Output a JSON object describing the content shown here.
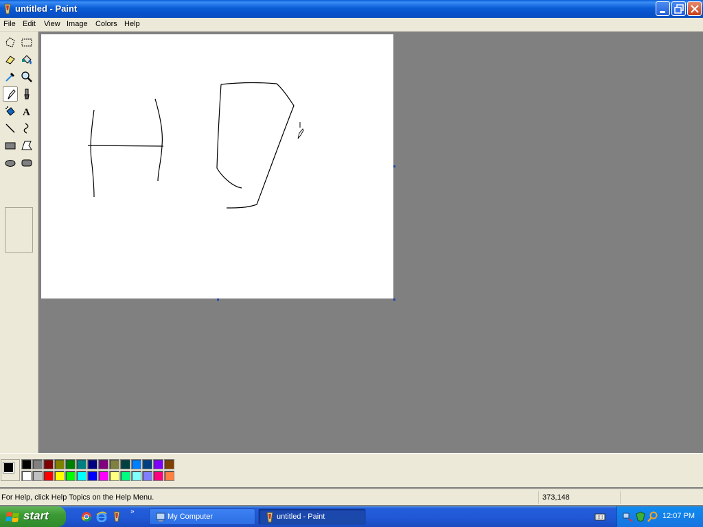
{
  "window": {
    "title": "untitled - Paint",
    "controls": [
      "minimize-icon",
      "maximize-icon",
      "close-icon"
    ]
  },
  "menubar": {
    "items": [
      "File",
      "Edit",
      "View",
      "Image",
      "Colors",
      "Help"
    ]
  },
  "toolbox": {
    "tools": [
      {
        "name": "free-form-select-icon"
      },
      {
        "name": "select-icon"
      },
      {
        "name": "eraser-icon"
      },
      {
        "name": "fill-with-color-icon"
      },
      {
        "name": "pick-color-icon"
      },
      {
        "name": "magnifier-icon"
      },
      {
        "name": "pencil-icon",
        "selected": true
      },
      {
        "name": "brush-icon"
      },
      {
        "name": "airbrush-icon"
      },
      {
        "name": "text-icon",
        "glyph": "A"
      },
      {
        "name": "line-icon"
      },
      {
        "name": "curve-icon"
      },
      {
        "name": "rectangle-icon"
      },
      {
        "name": "polygon-icon"
      },
      {
        "name": "ellipse-icon"
      },
      {
        "name": "rounded-rectangle-icon"
      }
    ]
  },
  "palette": {
    "foreground": "#000000",
    "background": "#FFFFFF",
    "row1": [
      "#000000",
      "#808080",
      "#800000",
      "#808000",
      "#008000",
      "#008080",
      "#000080",
      "#800080",
      "#808040",
      "#004040",
      "#0080FF",
      "#004080",
      "#8000FF",
      "#804000"
    ],
    "row2": [
      "#FFFFFF",
      "#C0C0C0",
      "#FF0000",
      "#FFFF00",
      "#00FF00",
      "#00FFFF",
      "#0000FF",
      "#FF00FF",
      "#FFFF80",
      "#00FF80",
      "#80FFFF",
      "#8080FF",
      "#FF0080",
      "#FF8040"
    ]
  },
  "statusbar": {
    "help_text": "For Help, click Help Topics on the Help Menu.",
    "coords": "373,148"
  },
  "taskbar": {
    "start_label": "start",
    "quicklaunch": [
      "chrome-icon",
      "internet-explorer-icon",
      "paint-icon"
    ],
    "tasks": [
      {
        "label": "My Computer",
        "icon": "my-computer-icon",
        "active": false
      },
      {
        "label": "untitled - Paint",
        "icon": "paint-icon",
        "active": true
      }
    ],
    "tray_icons": [
      "keyboard-icon",
      "network-icon",
      "security-icon",
      "search-icon"
    ],
    "clock": "12:07 PM"
  }
}
